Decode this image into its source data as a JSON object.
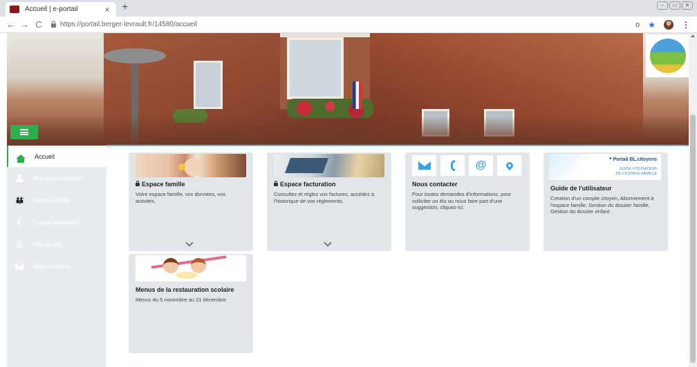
{
  "browser": {
    "tab_title": "Accueil | e-portail",
    "tab_close": "×",
    "new_tab": "+",
    "url": "https://portail.berger-levrault.fr/14580/accueil",
    "nav_back": "←",
    "nav_forward": "→",
    "nav_reload": "C",
    "key_icon": "o",
    "star_icon": "★",
    "menu_icon": "⋮",
    "win_minimize": "–",
    "win_restore": "▭",
    "win_close": "✕"
  },
  "sidebar": {
    "items": [
      {
        "label": "Accueil",
        "icon": "home-icon"
      },
      {
        "label": "Mon espace citoyen",
        "icon": "person-icon"
      },
      {
        "label": "Espace famille",
        "icon": "family-icon",
        "glyph": "👪"
      },
      {
        "label": "Espace facturation",
        "icon": "euro-icon",
        "glyph": "€"
      },
      {
        "label": "Plan du site",
        "icon": "sitemap-icon",
        "glyph": "品"
      },
      {
        "label": "Nous contacter",
        "icon": "mail-icon"
      }
    ]
  },
  "cards": {
    "famille": {
      "title": "Espace famille",
      "desc": "Votre espace famille, vos données, vos activités."
    },
    "facturation": {
      "title": "Espace facturation",
      "desc": "Consultez et réglez vos factures, accédez à l'historique de vos règlements."
    },
    "contact": {
      "title": "Nous contacter",
      "desc": "Pour toutes demandes d'informations, pour solliciter un élu ou nous faire part d'une suggestion, cliquez-ici.",
      "at_glyph": "@"
    },
    "guide": {
      "title": "Guide de l'utilisateur",
      "desc": "Création d'un compte citoyen, Abonnement à l'espace famille, Gestion du dossier famille, Gestion du dossier enfant",
      "brand": "❝ Portail BL.citoyens",
      "sub1": "GUIDE UTILISATEUR",
      "sub2": "DE L'ESPACE FAMILLE"
    },
    "menus": {
      "title": "Menus de la restauration scolaire",
      "desc": "Menus du 5 novembre au 21 décembre"
    }
  },
  "colors": {
    "accent_green": "#2fae4e",
    "card_bg": "#e2e6ea",
    "sidebar_bg": "#e9ecef",
    "contact_blue": "#3aa3e3"
  }
}
